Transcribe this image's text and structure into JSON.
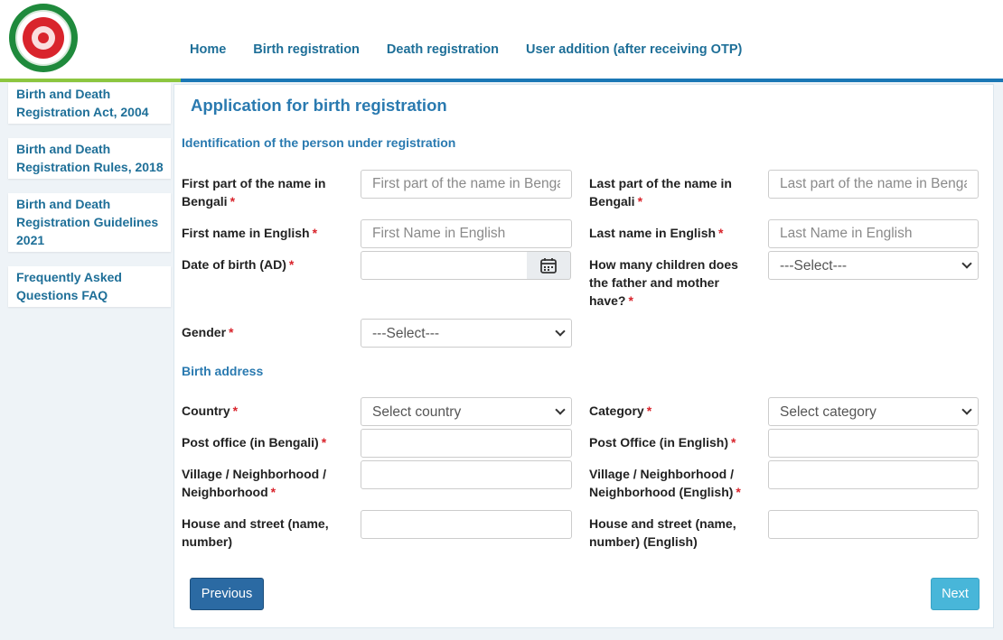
{
  "nav": {
    "items": [
      {
        "label": "Home"
      },
      {
        "label": "Birth registration"
      },
      {
        "label": "Death registration"
      },
      {
        "label": "User addition (after receiving OTP)"
      }
    ]
  },
  "sidebar": {
    "items": [
      {
        "line1": "Birth and Death",
        "line2": "Registration Act, 2004",
        "line3": ""
      },
      {
        "line1": "Birth and Death",
        "line2": "Registration Rules, 2018",
        "line3": ""
      },
      {
        "line1": "Birth and Death",
        "line2": "Registration Guidelines",
        "line3": "2021"
      },
      {
        "line1": "Frequently Asked",
        "line2": "Questions FAQ",
        "line3": ""
      }
    ]
  },
  "form": {
    "title": "Application for birth registration",
    "section_identification": "Identification of the person under registration",
    "section_address": "Birth address",
    "required_mark": "*",
    "fields": {
      "first_name_bn": {
        "label1": "First part of the name in",
        "label2": "Bengali",
        "placeholder": "First part of the name in Bengali"
      },
      "last_name_bn": {
        "label1": "Last part of the name in",
        "label2": "Bengali",
        "placeholder": "Last part of the name in Bengali"
      },
      "first_name_en": {
        "label": "First name in English",
        "placeholder": "First Name in English"
      },
      "last_name_en": {
        "label": "Last name in English",
        "placeholder": "Last Name in English"
      },
      "dob": {
        "label": "Date of birth (AD)",
        "value": ""
      },
      "children": {
        "label1": "How many children does",
        "label2": "the father and mother",
        "label3": "have?",
        "selected": "---Select---"
      },
      "gender": {
        "label": "Gender",
        "selected": "---Select---"
      },
      "country": {
        "label": "Country",
        "selected": "Select country"
      },
      "category": {
        "label": "Category",
        "selected": "Select category"
      },
      "post_office_bn": {
        "label": "Post office (in Bengali)",
        "value": ""
      },
      "post_office_en": {
        "label": "Post Office (in English)",
        "value": ""
      },
      "village_bn": {
        "label1": "Village / Neighborhood /",
        "label2": "Neighborhood",
        "value": ""
      },
      "village_en": {
        "label1": "Village / Neighborhood /",
        "label2": "Neighborhood (English)",
        "value": ""
      },
      "house_bn": {
        "label1": "House and street (name,",
        "label2": "number)",
        "value": ""
      },
      "house_en": {
        "label1": "House and street (name,",
        "label2": "number) (English)",
        "value": ""
      }
    },
    "buttons": {
      "previous": "Previous",
      "next": "Next"
    }
  },
  "colors": {
    "link": "#1e6f98",
    "title": "#2a7ab0",
    "required": "#d9242c",
    "bar_green": "#8cc63f",
    "bar_blue": "#1a77b5",
    "btn_previous": "#2b6aa3",
    "btn_next": "#48b6d9"
  },
  "icons": {
    "logo": "government-seal-logo",
    "calendar": "calendar-icon",
    "dropdown": "chevron-down-icon"
  }
}
